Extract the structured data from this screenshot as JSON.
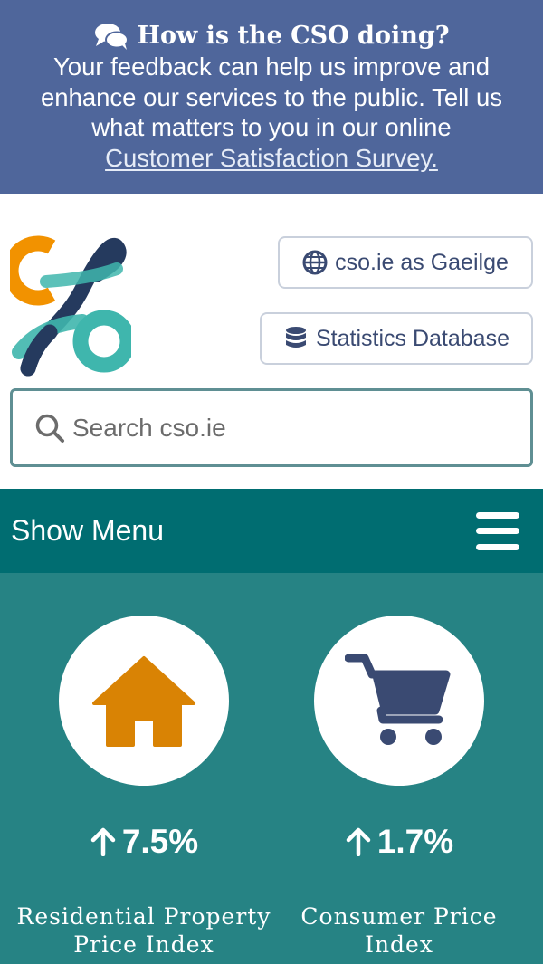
{
  "feedback": {
    "title": "How is the CSO doing?",
    "text": "Your feedback can help us improve and enhance our services to the public. Tell us what matters to you in our online",
    "link_text": "Customer Satisfaction Survey."
  },
  "header": {
    "language_button": "cso.ie as Gaeilge",
    "database_button": "Statistics Database",
    "search_placeholder": "Search cso.ie"
  },
  "menu": {
    "label": "Show Menu"
  },
  "stats": [
    {
      "icon": "house-icon",
      "value": "7.5%",
      "trend": "up",
      "label": "Residential Property Price Index",
      "icon_color": "#d98304"
    },
    {
      "icon": "shopping-cart-icon",
      "value": "1.7%",
      "trend": "up",
      "label": "Consumer Price Index",
      "icon_color": "#3a4a72"
    }
  ],
  "colors": {
    "banner_bg": "#4f669b",
    "menu_bg": "#006d71",
    "stats_bg": "#268384",
    "logo_orange": "#f29200",
    "logo_teal": "#3fb6ad",
    "logo_navy": "#253a5e"
  }
}
